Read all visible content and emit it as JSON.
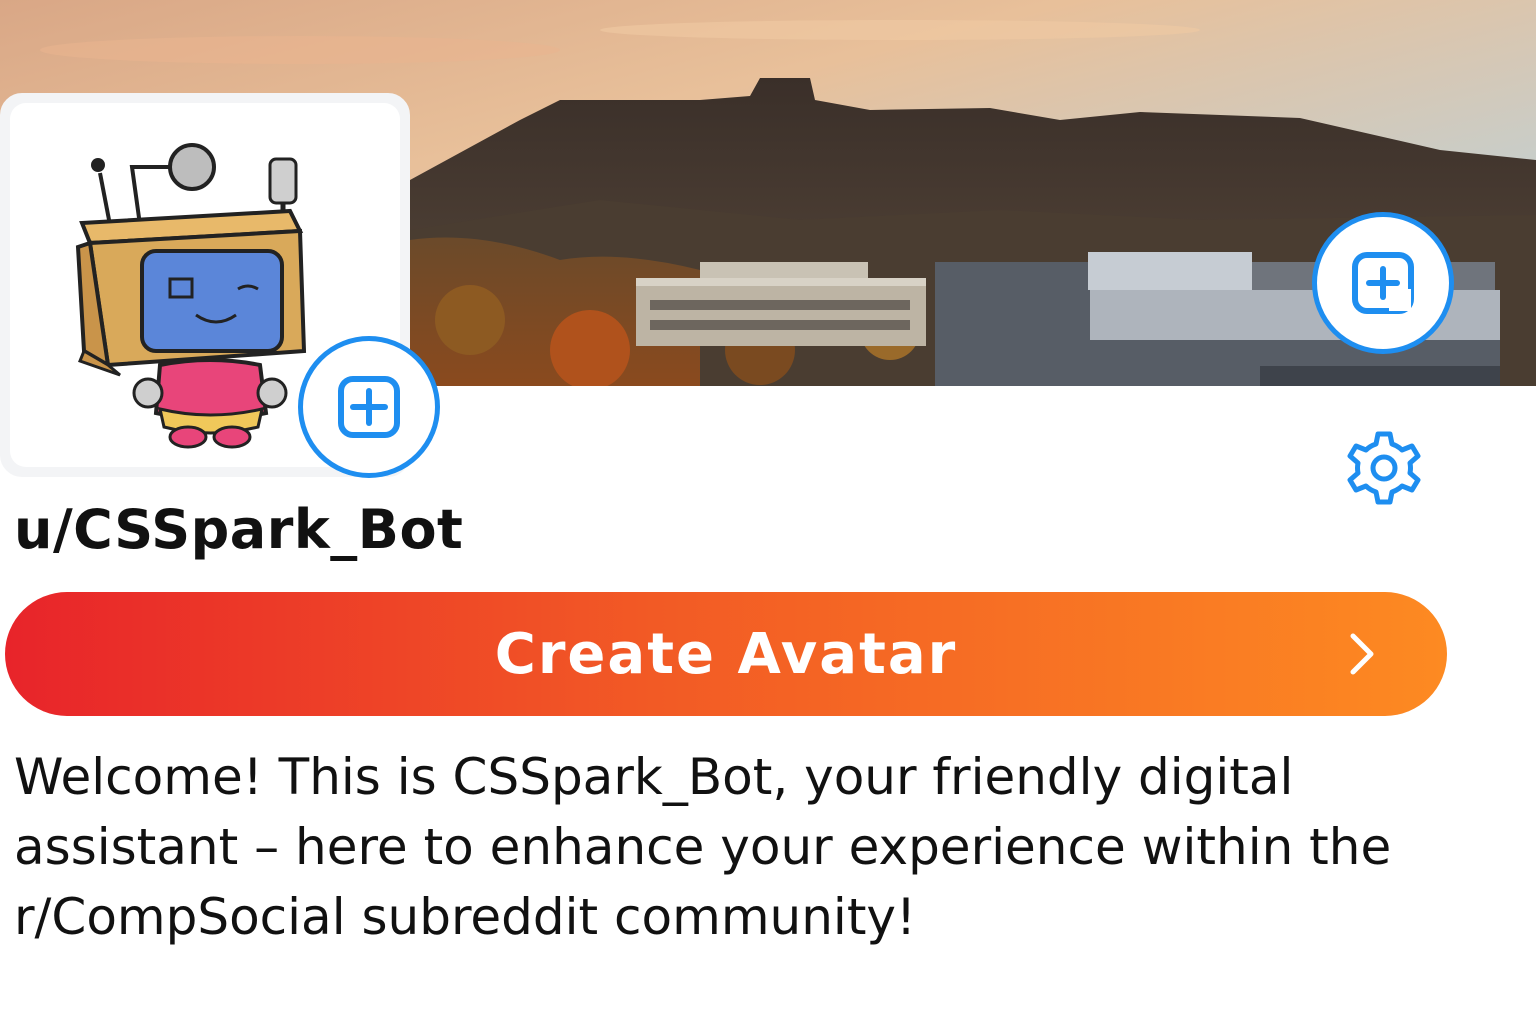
{
  "profile": {
    "username": "u/CSSpark_Bot",
    "bio": "Welcome! This is CSSpark_Bot, your friendly digital assistant – here to enhance your experience within the r/CompSocial subreddit community!"
  },
  "actions": {
    "create_avatar_label": "Create Avatar"
  },
  "icons": {
    "banner_add": "add-image-icon",
    "avatar_add": "add-icon",
    "settings": "gear-icon",
    "chevron": "chevron-right-icon"
  },
  "colors": {
    "accent": "#1e8ef0",
    "button_gradient_start": "#e8242a",
    "button_gradient_end": "#fd8a22"
  }
}
